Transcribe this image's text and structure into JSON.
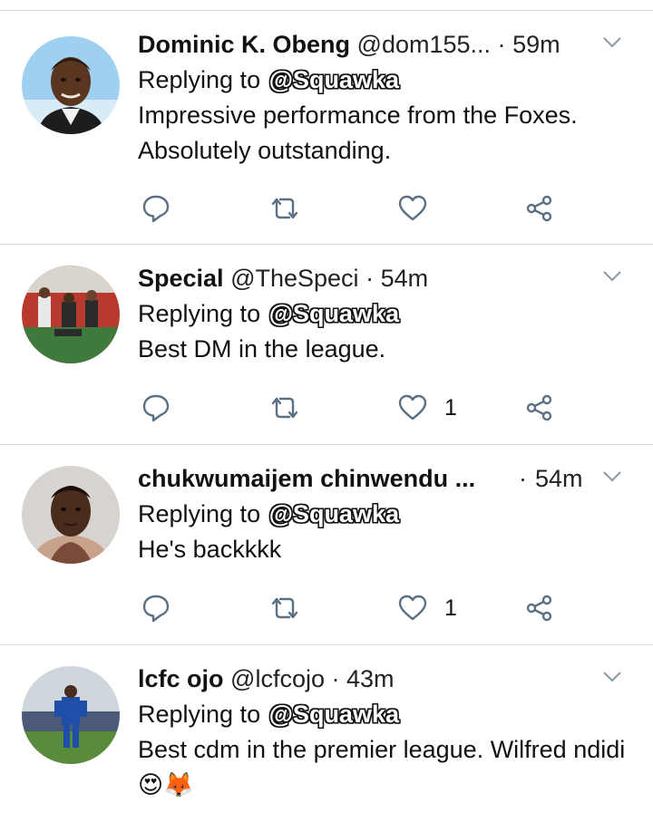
{
  "tweets": [
    {
      "name": "Dominic K. Obeng",
      "handle": "@dom155...",
      "time": "59m",
      "reply_prefix": "Replying to",
      "mention": "@Squawka",
      "text": "Impressive performance from the Foxes. Absolutely outstanding.",
      "likes": "",
      "avatar": "man-portrait-blue-icon"
    },
    {
      "name": "Special",
      "handle": "@TheSpeci",
      "time": "54m",
      "reply_prefix": "Replying to",
      "mention": "@Squawka",
      "text": "Best DM in the league.",
      "likes": "1",
      "avatar": "footballers-stadium-icon"
    },
    {
      "name": "chukwumaijem chinwendu ...",
      "handle": "",
      "time": "54m",
      "reply_prefix": "Replying to",
      "mention": "@Squawka",
      "text": "He's backkkk",
      "likes": "1",
      "avatar": "young-man-selfie-icon"
    },
    {
      "name": "lcfc ojo",
      "handle": "@lcfcojo",
      "time": "43m",
      "reply_prefix": "Replying to",
      "mention": "@Squawka",
      "text": "Best cdm in the premier league. Wilfred ndidi😍🦊",
      "likes": "",
      "avatar": "leicester-player-icon"
    }
  ],
  "separator": "·",
  "colors": {
    "icon": "#5b7083",
    "text": "#111111",
    "divider": "#d9d9d9"
  }
}
